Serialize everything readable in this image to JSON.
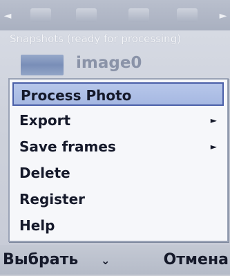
{
  "toolbar": {
    "left_arrow": "◄",
    "right_arrow": "►",
    "icons": [
      "photo-icon",
      "film-icon",
      "frame-icon",
      "grid-icon"
    ]
  },
  "subtitle": "Snapshots (ready for processing)",
  "file": {
    "name": "image0",
    "icon": "folder-thumbnail"
  },
  "menu": {
    "items": [
      {
        "label": "Process Photo",
        "selected": true,
        "has_submenu": false
      },
      {
        "label": "Export",
        "selected": false,
        "has_submenu": true
      },
      {
        "label": "Save frames",
        "selected": false,
        "has_submenu": true
      },
      {
        "label": "Delete",
        "selected": false,
        "has_submenu": false
      },
      {
        "label": "Register",
        "selected": false,
        "has_submenu": false
      },
      {
        "label": "Help",
        "selected": false,
        "has_submenu": false
      }
    ],
    "submenu_glyph": "►"
  },
  "softkeys": {
    "left": "Выбрать",
    "chevron": "⌄",
    "right": "Отмена"
  },
  "colors": {
    "selection_fill": "#b0c1e7",
    "selection_border": "#4a5fa8",
    "menu_bg": "#f6f7fa",
    "text": "#15192a"
  }
}
